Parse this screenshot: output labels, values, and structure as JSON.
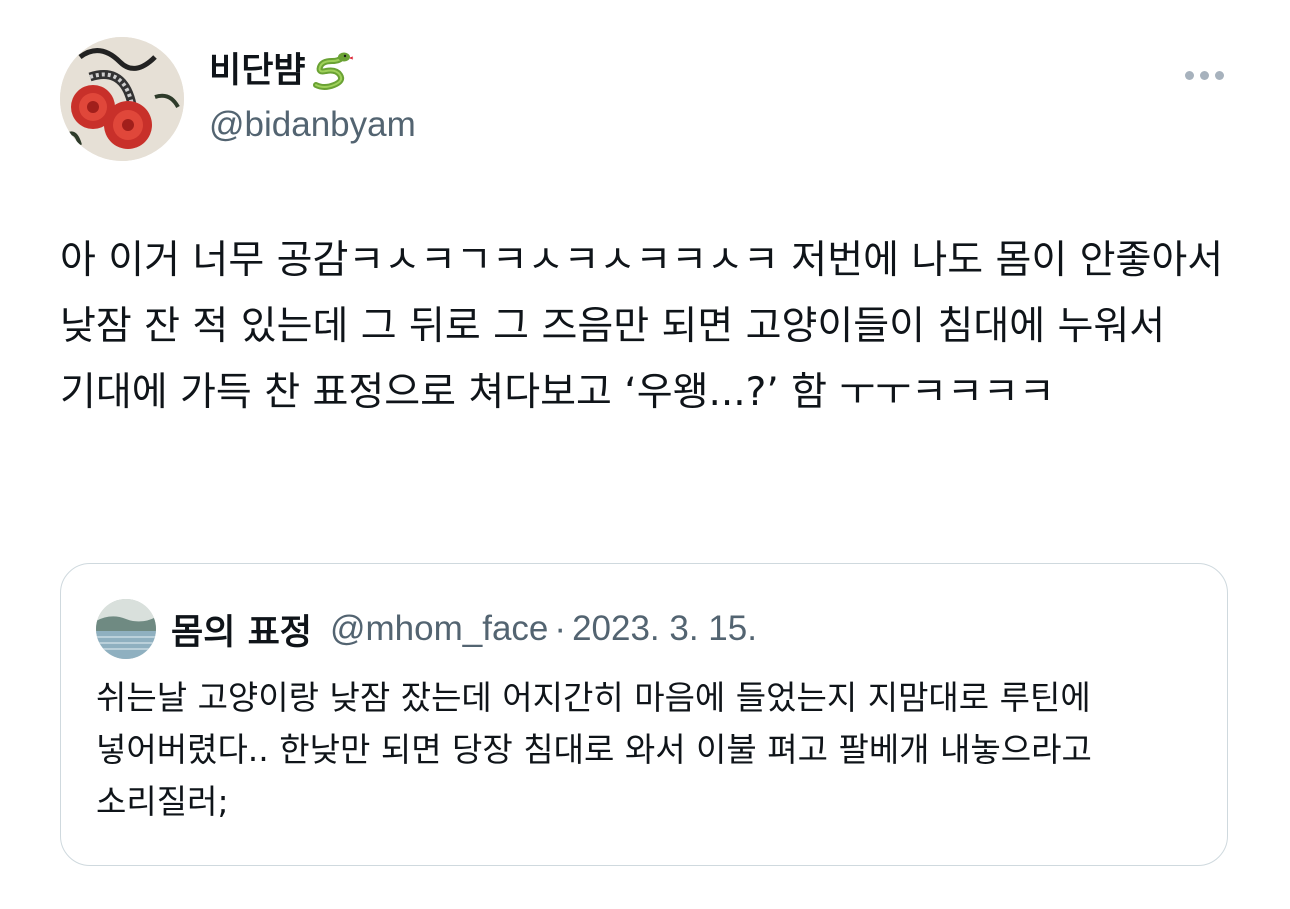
{
  "author": {
    "display_name": "비단뱜",
    "handle": "@bidanbyam",
    "emoji_icon": "snake-icon"
  },
  "menu": {
    "icon": "more-dots-icon"
  },
  "tweet": {
    "text": "아 이거 너무 공감ㅋㅅㅋㄱㅋㅅㅋㅅㅋㅋㅅㅋ 저번에 나도 몸이 안좋아서 낮잠 잔 적 있는데 그 뒤로 그 즈음만 되면 고양이들이 침대에 누워서 기대에 가득 찬 표정으로 쳐다보고 ‘우왱...?’ 함 ㅜㅜㅋㅋㅋㅋ"
  },
  "quoted_tweet": {
    "display_name": "몸의 표정",
    "handle": "@mhom_face",
    "separator": "·",
    "date": "2023. 3. 15.",
    "text": "쉬는날 고양이랑 낮잠 잤는데 어지간히 마음에 들었는지 지맘대로 루틴에 넣어버렸다.. 한낮만 되면 당장 침대로 와서 이불 펴고 팔베개 내놓으라고 소리질러;"
  },
  "colors": {
    "text_primary": "#0f1419",
    "text_secondary": "#536471",
    "border": "#cfd9de"
  }
}
